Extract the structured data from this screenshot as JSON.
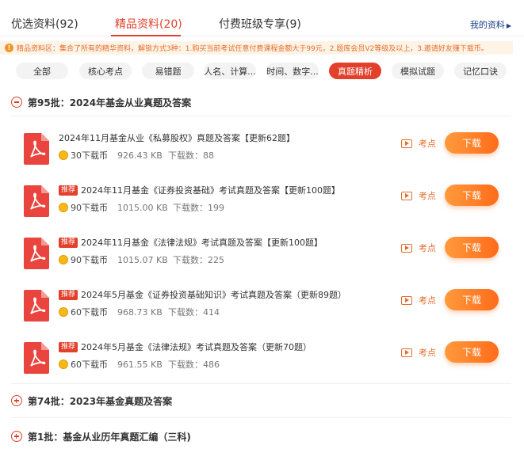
{
  "tabs": [
    {
      "label": "优选资料(92)"
    },
    {
      "label": "精品资料(20)"
    },
    {
      "label": "付费班级专享(9)"
    }
  ],
  "my_data_link": "我的资料",
  "notice": "精品资料区：集合了所有的精华资料，解锁方式3种：1.购买当前考试任意付费课程金额大于99元，2.题库会员V2等级及以上，3.邀请好友赚下载币。",
  "filters": [
    "全部",
    "核心考点",
    "易错题",
    "人名、计算...",
    "时间、数字...",
    "真题精析",
    "模拟试题",
    "记忆口诀"
  ],
  "active_filter": "真题精析",
  "batches": [
    {
      "title": "第95批：2024年基金从业真题及答案",
      "expanded": true,
      "items": [
        {
          "tag": "",
          "title": "2024年11月基金从业《私募股权》真题及答案【更新62题】",
          "coins": "30下载币",
          "size": "926.43 KB",
          "downloads": "下载数：88",
          "point_label": "考点",
          "download_label": "下载"
        },
        {
          "tag": "推荐",
          "title": "2024年11月基金《证券投资基础》考试真题及答案【更新100题】",
          "coins": "90下载币",
          "size": "1015.00 KB",
          "downloads": "下载数：199",
          "point_label": "考点",
          "download_label": "下载"
        },
        {
          "tag": "推荐",
          "title": "2024年11月基金《法律法规》考试真题及答案【更新100题】",
          "coins": "90下载币",
          "size": "1015.07 KB",
          "downloads": "下载数：225",
          "point_label": "考点",
          "download_label": "下载"
        },
        {
          "tag": "推荐",
          "title": "2024年5月基金《证券投资基础知识》考试真题及答案（更新89题）",
          "coins": "60下载币",
          "size": "968.73 KB",
          "downloads": "下载数：414",
          "point_label": "考点",
          "download_label": "下载"
        },
        {
          "tag": "推荐",
          "title": "2024年5月基金《法律法规》考试真题及答案（更新70题）",
          "coins": "60下载币",
          "size": "961.55 KB",
          "downloads": "下载数：486",
          "point_label": "考点",
          "download_label": "下载"
        }
      ]
    },
    {
      "title": "第74批：2023年基金真题及答案",
      "expanded": false
    },
    {
      "title": "第1批：基金从业历年真题汇编（三科)",
      "expanded": false
    }
  ],
  "colors": {
    "accent": "#e2402b",
    "button": "#ff7a22",
    "notice_bg": "#fdf4e7",
    "notice_text": "#e46d2c",
    "link": "#1a3f8a"
  },
  "icons": {
    "pdf": "pdf-file-icon",
    "coin": "coin-icon",
    "play": "play-icon",
    "expand": "plus-circle-icon",
    "collapse": "minus-circle-icon"
  }
}
